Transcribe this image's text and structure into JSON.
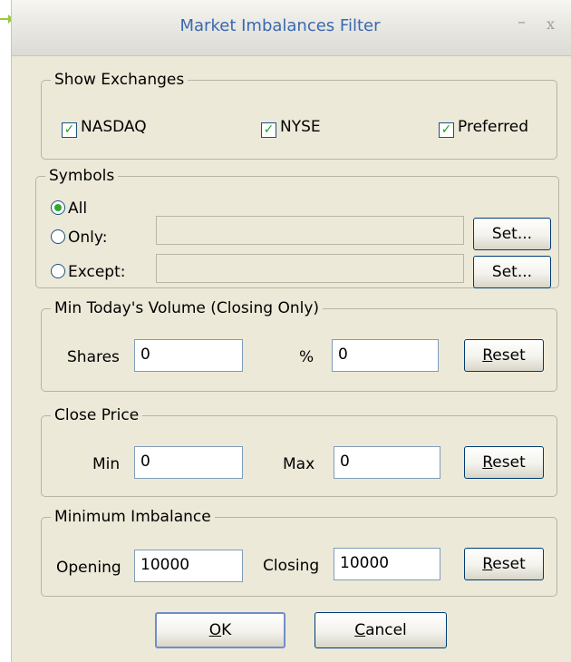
{
  "window": {
    "title": "Market Imbalances Filter",
    "minimize_glyph": "–",
    "close_glyph": "x"
  },
  "exchanges": {
    "legend": "Show Exchanges",
    "items": [
      {
        "label": "NASDAQ",
        "checked": true
      },
      {
        "label": "NYSE",
        "checked": true
      },
      {
        "label": "Preferred",
        "checked": true
      }
    ]
  },
  "symbols": {
    "legend": "Symbols",
    "all_label": "All",
    "only_label": "Only:",
    "except_label": "Except:",
    "only_value": "",
    "except_value": "",
    "set_label": "Set...",
    "selected": "All"
  },
  "volume": {
    "legend": "Min Today's Volume (Closing Only)",
    "shares_label": "Shares",
    "shares_value": "0",
    "percent_label": "%",
    "percent_value": "0",
    "reset_label": "Reset"
  },
  "close_price": {
    "legend": "Close Price",
    "min_label": "Min",
    "min_value": "0",
    "max_label": "Max",
    "max_value": "0",
    "reset_label": "Reset"
  },
  "imbalance": {
    "legend": "Minimum Imbalance",
    "opening_label": "Opening",
    "opening_value": "10000",
    "closing_label": "Closing",
    "closing_value": "10000",
    "reset_label": "Reset"
  },
  "footer": {
    "ok_label": "OK",
    "cancel_label": "Cancel"
  },
  "colors": {
    "title": "#3a69b0",
    "dialog_bg": "#ece9d8",
    "accent": "#9bc83c",
    "check": "#21a121"
  }
}
